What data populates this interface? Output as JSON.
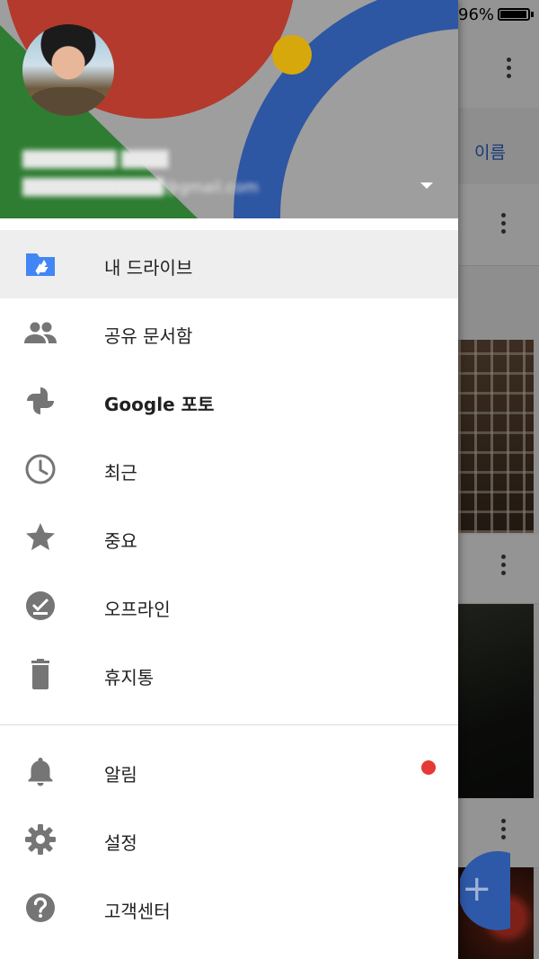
{
  "status_bar": {
    "battery_percent": "96%"
  },
  "background_app": {
    "sort_label": "이름",
    "fab_icon": "plus-icon"
  },
  "drawer": {
    "header": {
      "account_name": "████████ ████",
      "account_email": "████████████@gmail.com",
      "account_switcher_icon": "arrow-drop-down-icon"
    },
    "items": [
      {
        "label": "내 드라이브",
        "icon": "drive-folder-icon",
        "active": true
      },
      {
        "label": "공유 문서함",
        "icon": "people-icon",
        "active": false
      },
      {
        "label": "Google 포토",
        "icon": "pinwheel-icon",
        "active": false
      },
      {
        "label": "최근",
        "icon": "clock-icon",
        "active": false
      },
      {
        "label": "중요",
        "icon": "star-icon",
        "active": false
      },
      {
        "label": "오프라인",
        "icon": "offline-check-icon",
        "active": false
      },
      {
        "label": "휴지통",
        "icon": "trash-icon",
        "active": false
      },
      {
        "label": "알림",
        "icon": "bell-icon",
        "active": false,
        "badge_color": "#e53935"
      },
      {
        "label": "설정",
        "icon": "gear-icon",
        "active": false
      },
      {
        "label": "고객센터",
        "icon": "help-icon",
        "active": false
      }
    ]
  },
  "colors": {
    "active_item_bg": "#eeeeee",
    "drive_icon_blue": "#4285f4",
    "icon_gray": "#757575",
    "header_red": "#b33a2c",
    "header_blue": "#2d56a3",
    "header_green": "#2e7d32",
    "header_yellow": "#d7a80b"
  }
}
